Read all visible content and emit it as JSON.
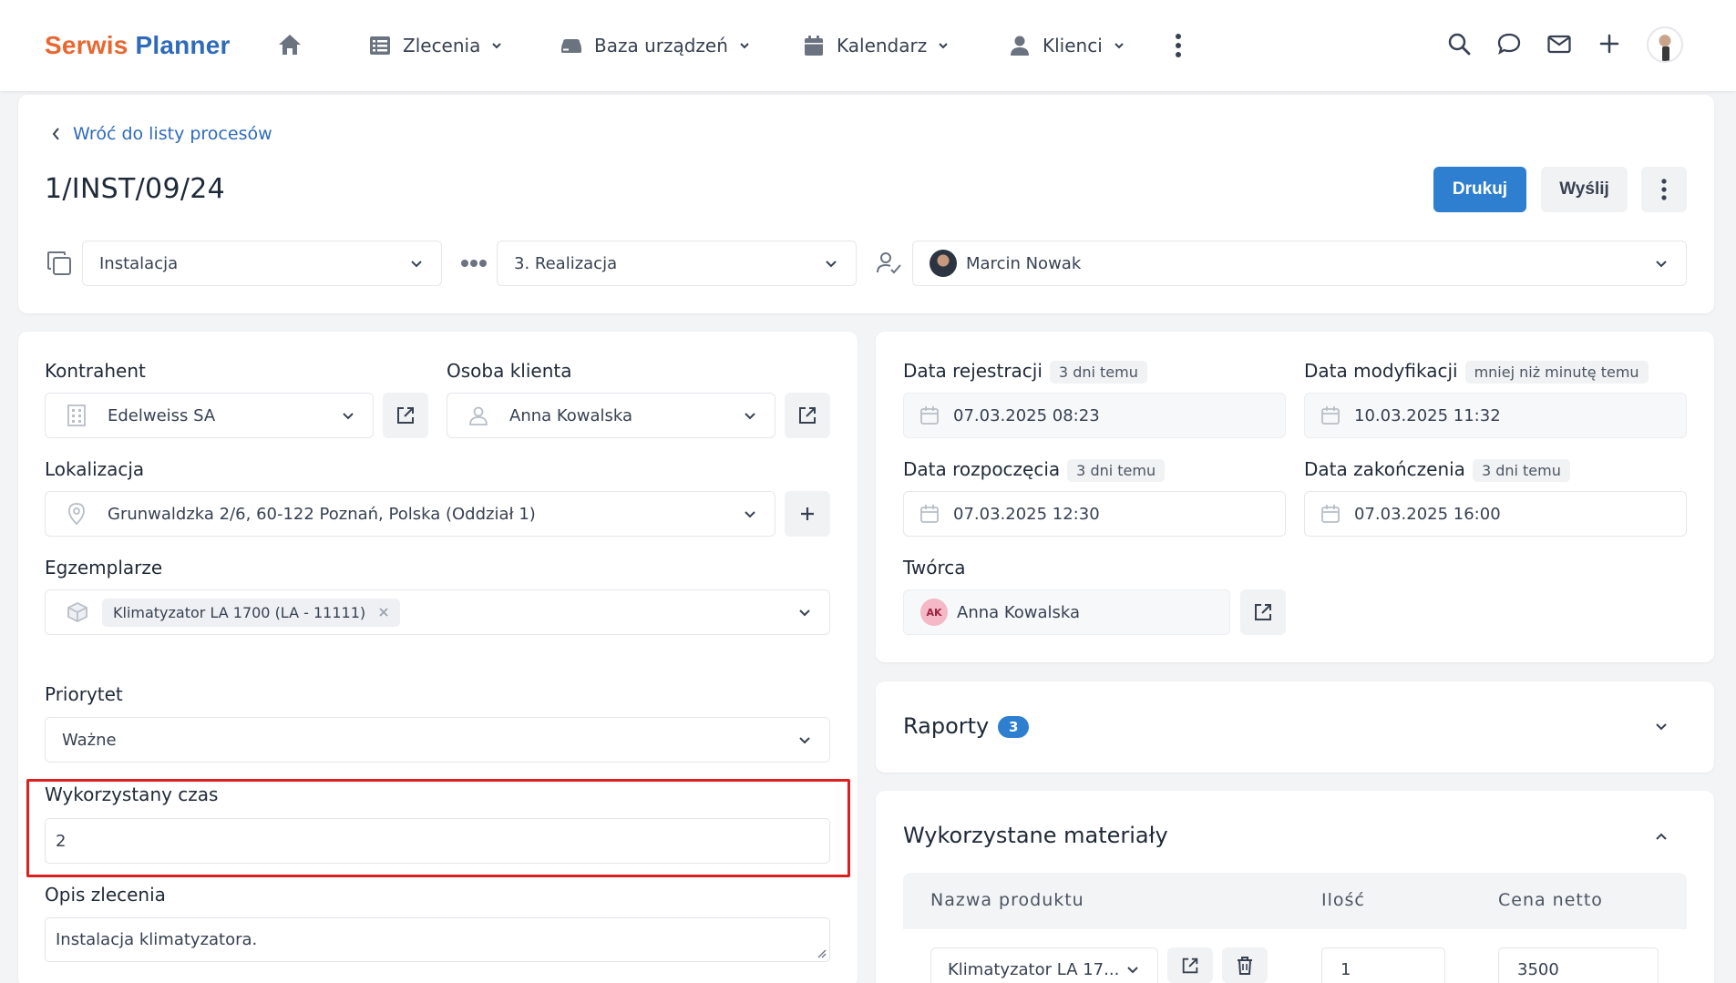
{
  "app": {
    "logo_part1": "Serwis",
    "logo_part2": "Planner",
    "brand_orange": "#e8662f",
    "brand_blue": "#2f6bb8",
    "accent": "#2f7fd0",
    "highlight": "#dc1f1f"
  },
  "nav": {
    "items": [
      {
        "label": "Zlecenia",
        "icon": "list-icon"
      },
      {
        "label": "Baza urządzeń",
        "icon": "device-icon"
      },
      {
        "label": "Kalendarz",
        "icon": "calendar-icon"
      },
      {
        "label": "Klienci",
        "icon": "user-icon"
      }
    ]
  },
  "header": {
    "back_label": "Wróć do listy procesów",
    "title": "1/INST/09/24",
    "print_label": "Drukuj",
    "send_label": "Wyślij",
    "type_value": "Instalacja",
    "stage_value": "3. Realizacja",
    "assignee_value": "Marcin Nowak"
  },
  "form": {
    "client_label": "Kontrahent",
    "client_value": "Edelweiss SA",
    "contact_label": "Osoba klienta",
    "contact_value": "Anna Kowalska",
    "location_label": "Lokalizacja",
    "location_value": "Grunwaldzka 2/6, 60-122 Poznań, Polska (Oddział 1)",
    "units_label": "Egzemplarze",
    "unit_chip": "Klimatyzator LA 1700 (LA - 11111)",
    "priority_label": "Priorytet",
    "priority_value": "Ważne",
    "time_label": "Wykorzystany czas",
    "time_value": "2",
    "description_label": "Opis zlecenia",
    "description_value": "Instalacja klimatyzatora."
  },
  "dates": {
    "registered_label": "Data rejestracji",
    "registered_badge": "3 dni temu",
    "registered_value": "07.03.2025 08:23",
    "modified_label": "Data modyfikacji",
    "modified_badge": "mniej niż minutę temu",
    "modified_value": "10.03.2025 11:32",
    "start_label": "Data rozpoczęcia",
    "start_badge": "3 dni temu",
    "start_value": "07.03.2025 12:30",
    "end_label": "Data zakończenia",
    "end_badge": "3 dni temu",
    "end_value": "07.03.2025 16:00",
    "creator_label": "Twórca",
    "creator_initials": "AK",
    "creator_value": "Anna Kowalska"
  },
  "reports": {
    "title": "Raporty",
    "count": "3"
  },
  "materials": {
    "title": "Wykorzystane materiały",
    "columns": [
      "Nazwa produktu",
      "Ilość",
      "Cena netto"
    ],
    "rows": [
      {
        "product": "Klimatyzator LA 17...",
        "qty": "1",
        "price": "3500"
      }
    ]
  }
}
